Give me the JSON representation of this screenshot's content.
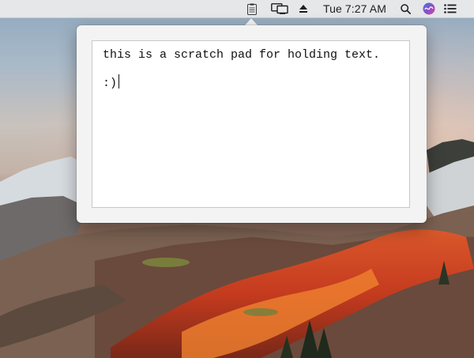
{
  "menubar": {
    "clock": "Tue 7:27 AM",
    "icons": [
      "scratchpad-icon",
      "display-mirroring-icon",
      "eject-icon",
      "spotlight-search-icon",
      "siri-icon",
      "notification-center-icon"
    ]
  },
  "scratchpad": {
    "lines": [
      "this is a scratch pad for holding text.",
      ":)"
    ]
  },
  "colors": {
    "menubar_bg": "#ececec",
    "popover_bg": "#f3f3f3",
    "text_area_bg": "#ffffff"
  }
}
